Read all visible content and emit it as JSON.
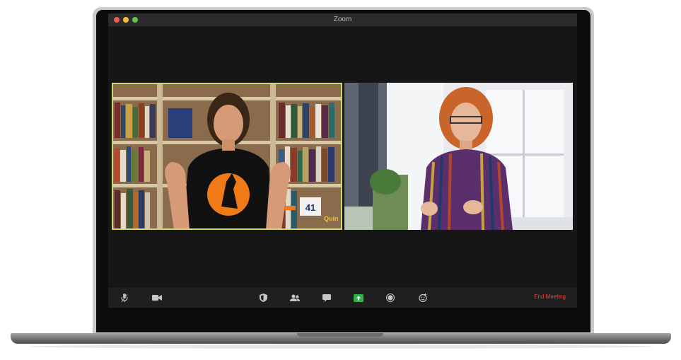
{
  "window": {
    "title": "Zoom"
  },
  "participants": [
    {
      "role": "active-speaker",
      "shirt_color": "#f07a17",
      "frame_color": "#cdd96a"
    },
    {
      "role": "participant"
    }
  ],
  "background_text": {
    "sign_number": "41",
    "sign_word": "Quin"
  },
  "toolbar": {
    "icons": [
      "microphone-icon",
      "video-camera-icon",
      "security-shield-icon",
      "participants-icon",
      "chat-bubble-icon",
      "share-screen-icon",
      "record-icon",
      "reactions-icon"
    ],
    "share_color": "#2fb24a",
    "end_meeting_label": "End Meeting",
    "end_meeting_color": "#e2483c"
  }
}
